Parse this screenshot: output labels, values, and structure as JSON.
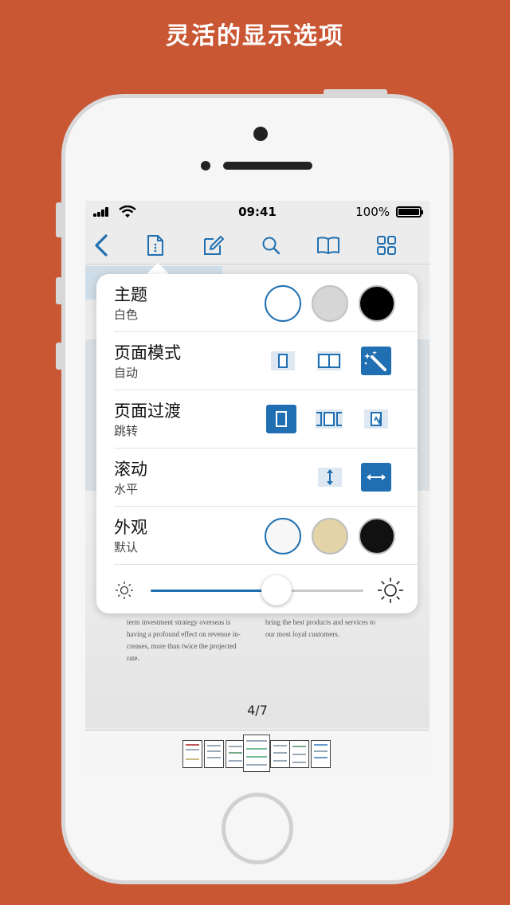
{
  "headline": "灵活的显示选项",
  "status_bar": {
    "time": "09:41",
    "battery": "100%"
  },
  "toolbar": {
    "icons": [
      "back-chevron-icon",
      "page-settings-icon",
      "edit-icon",
      "search-icon",
      "book-icon",
      "grid-icon"
    ],
    "accent": "#1f6fb2"
  },
  "popover": {
    "rows": [
      {
        "title": "主题",
        "subtitle": "白色",
        "options": [
          "white",
          "gray",
          "black"
        ],
        "selected": "white"
      },
      {
        "title": "页面模式",
        "subtitle": "自动",
        "options": [
          "single-page-icon",
          "two-page-icon",
          "auto-magic-icon"
        ],
        "selected": "auto-magic-icon"
      },
      {
        "title": "页面过渡",
        "subtitle": "跳转",
        "options": [
          "jump-transition-icon",
          "slide-transition-icon",
          "curl-transition-icon"
        ],
        "selected": "jump-transition-icon"
      },
      {
        "title": "滚动",
        "subtitle": "水平",
        "options": [
          "vertical-scroll-icon",
          "horizontal-scroll-icon"
        ],
        "selected": "horizontal-scroll-icon"
      },
      {
        "title": "外观",
        "subtitle": "默认",
        "options": [
          "default",
          "sepia",
          "dark"
        ],
        "selected": "default"
      }
    ],
    "brightness": 0.59,
    "colors": {
      "gray": "#d6d6d6",
      "sepia": "#e3d4a8",
      "black": "#000000",
      "dark": "#111111"
    }
  },
  "document": {
    "col1": [
      "term investment strategy overseas is",
      "having a profound effect on revenue in-",
      "creases, more than twice the projected",
      "rate."
    ],
    "col2": [
      "bring the best products and services to",
      "our most loyal customers."
    ],
    "page_indicator": "4/7"
  },
  "thumbnails": {
    "count": 7,
    "current_index": 3
  }
}
